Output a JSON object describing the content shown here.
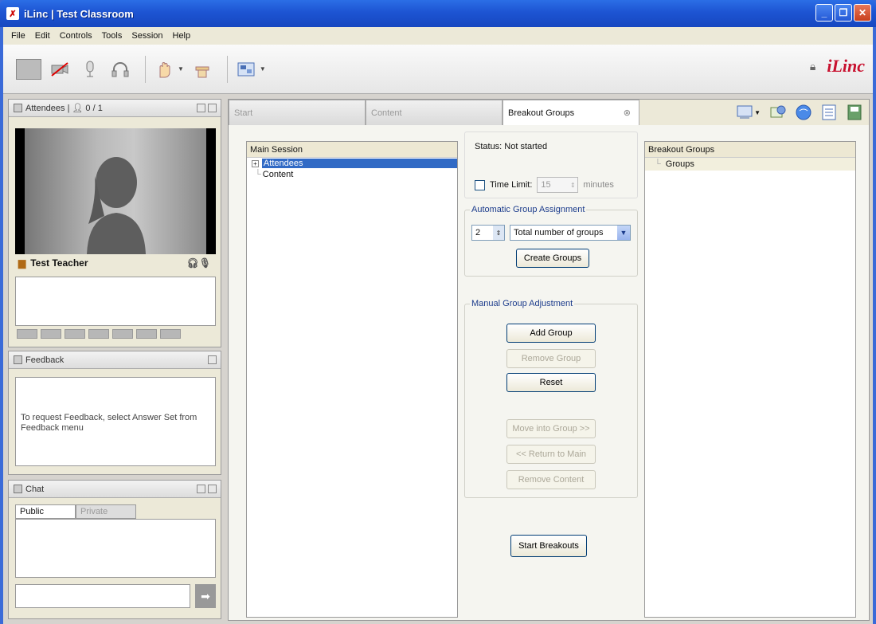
{
  "window": {
    "title": "iLinc | Test Classroom",
    "app_icon": "iLinc-app-icon"
  },
  "menu": [
    "File",
    "Edit",
    "Controls",
    "Tools",
    "Session",
    "Help"
  ],
  "logo": "iLinc",
  "attendees": {
    "header": "Attendees |",
    "count": "0 / 1",
    "teacher_name": "Test Teacher"
  },
  "feedback": {
    "header": "Feedback",
    "message": "To request Feedback, select Answer Set from Feedback menu"
  },
  "chat": {
    "header": "Chat",
    "tabs": [
      "Public",
      "Private"
    ]
  },
  "main_tabs": [
    {
      "label": "Start",
      "active": false
    },
    {
      "label": "Content",
      "active": false
    },
    {
      "label": "Breakout Groups",
      "active": true
    }
  ],
  "main_session": {
    "header": "Main Session",
    "items": [
      "Attendees",
      "Content"
    ]
  },
  "status": {
    "text": "Status: Not started",
    "time_limit_label": "Time Limit:",
    "time_limit_value": "15",
    "minutes_label": "minutes"
  },
  "auto_assign": {
    "legend": "Automatic Group Assignment",
    "number": "2",
    "mode": "Total number of groups",
    "create_button": "Create Groups"
  },
  "manual_adjust": {
    "legend": "Manual Group Adjustment",
    "add_group": "Add Group",
    "remove_group": "Remove Group",
    "reset": "Reset",
    "move_into_group": "Move into Group >>",
    "return_to_main": "<< Return to Main",
    "remove_content": "Remove Content"
  },
  "start_breakouts": "Start Breakouts",
  "breakout_groups": {
    "header": "Breakout Groups",
    "items": [
      "Groups"
    ]
  }
}
